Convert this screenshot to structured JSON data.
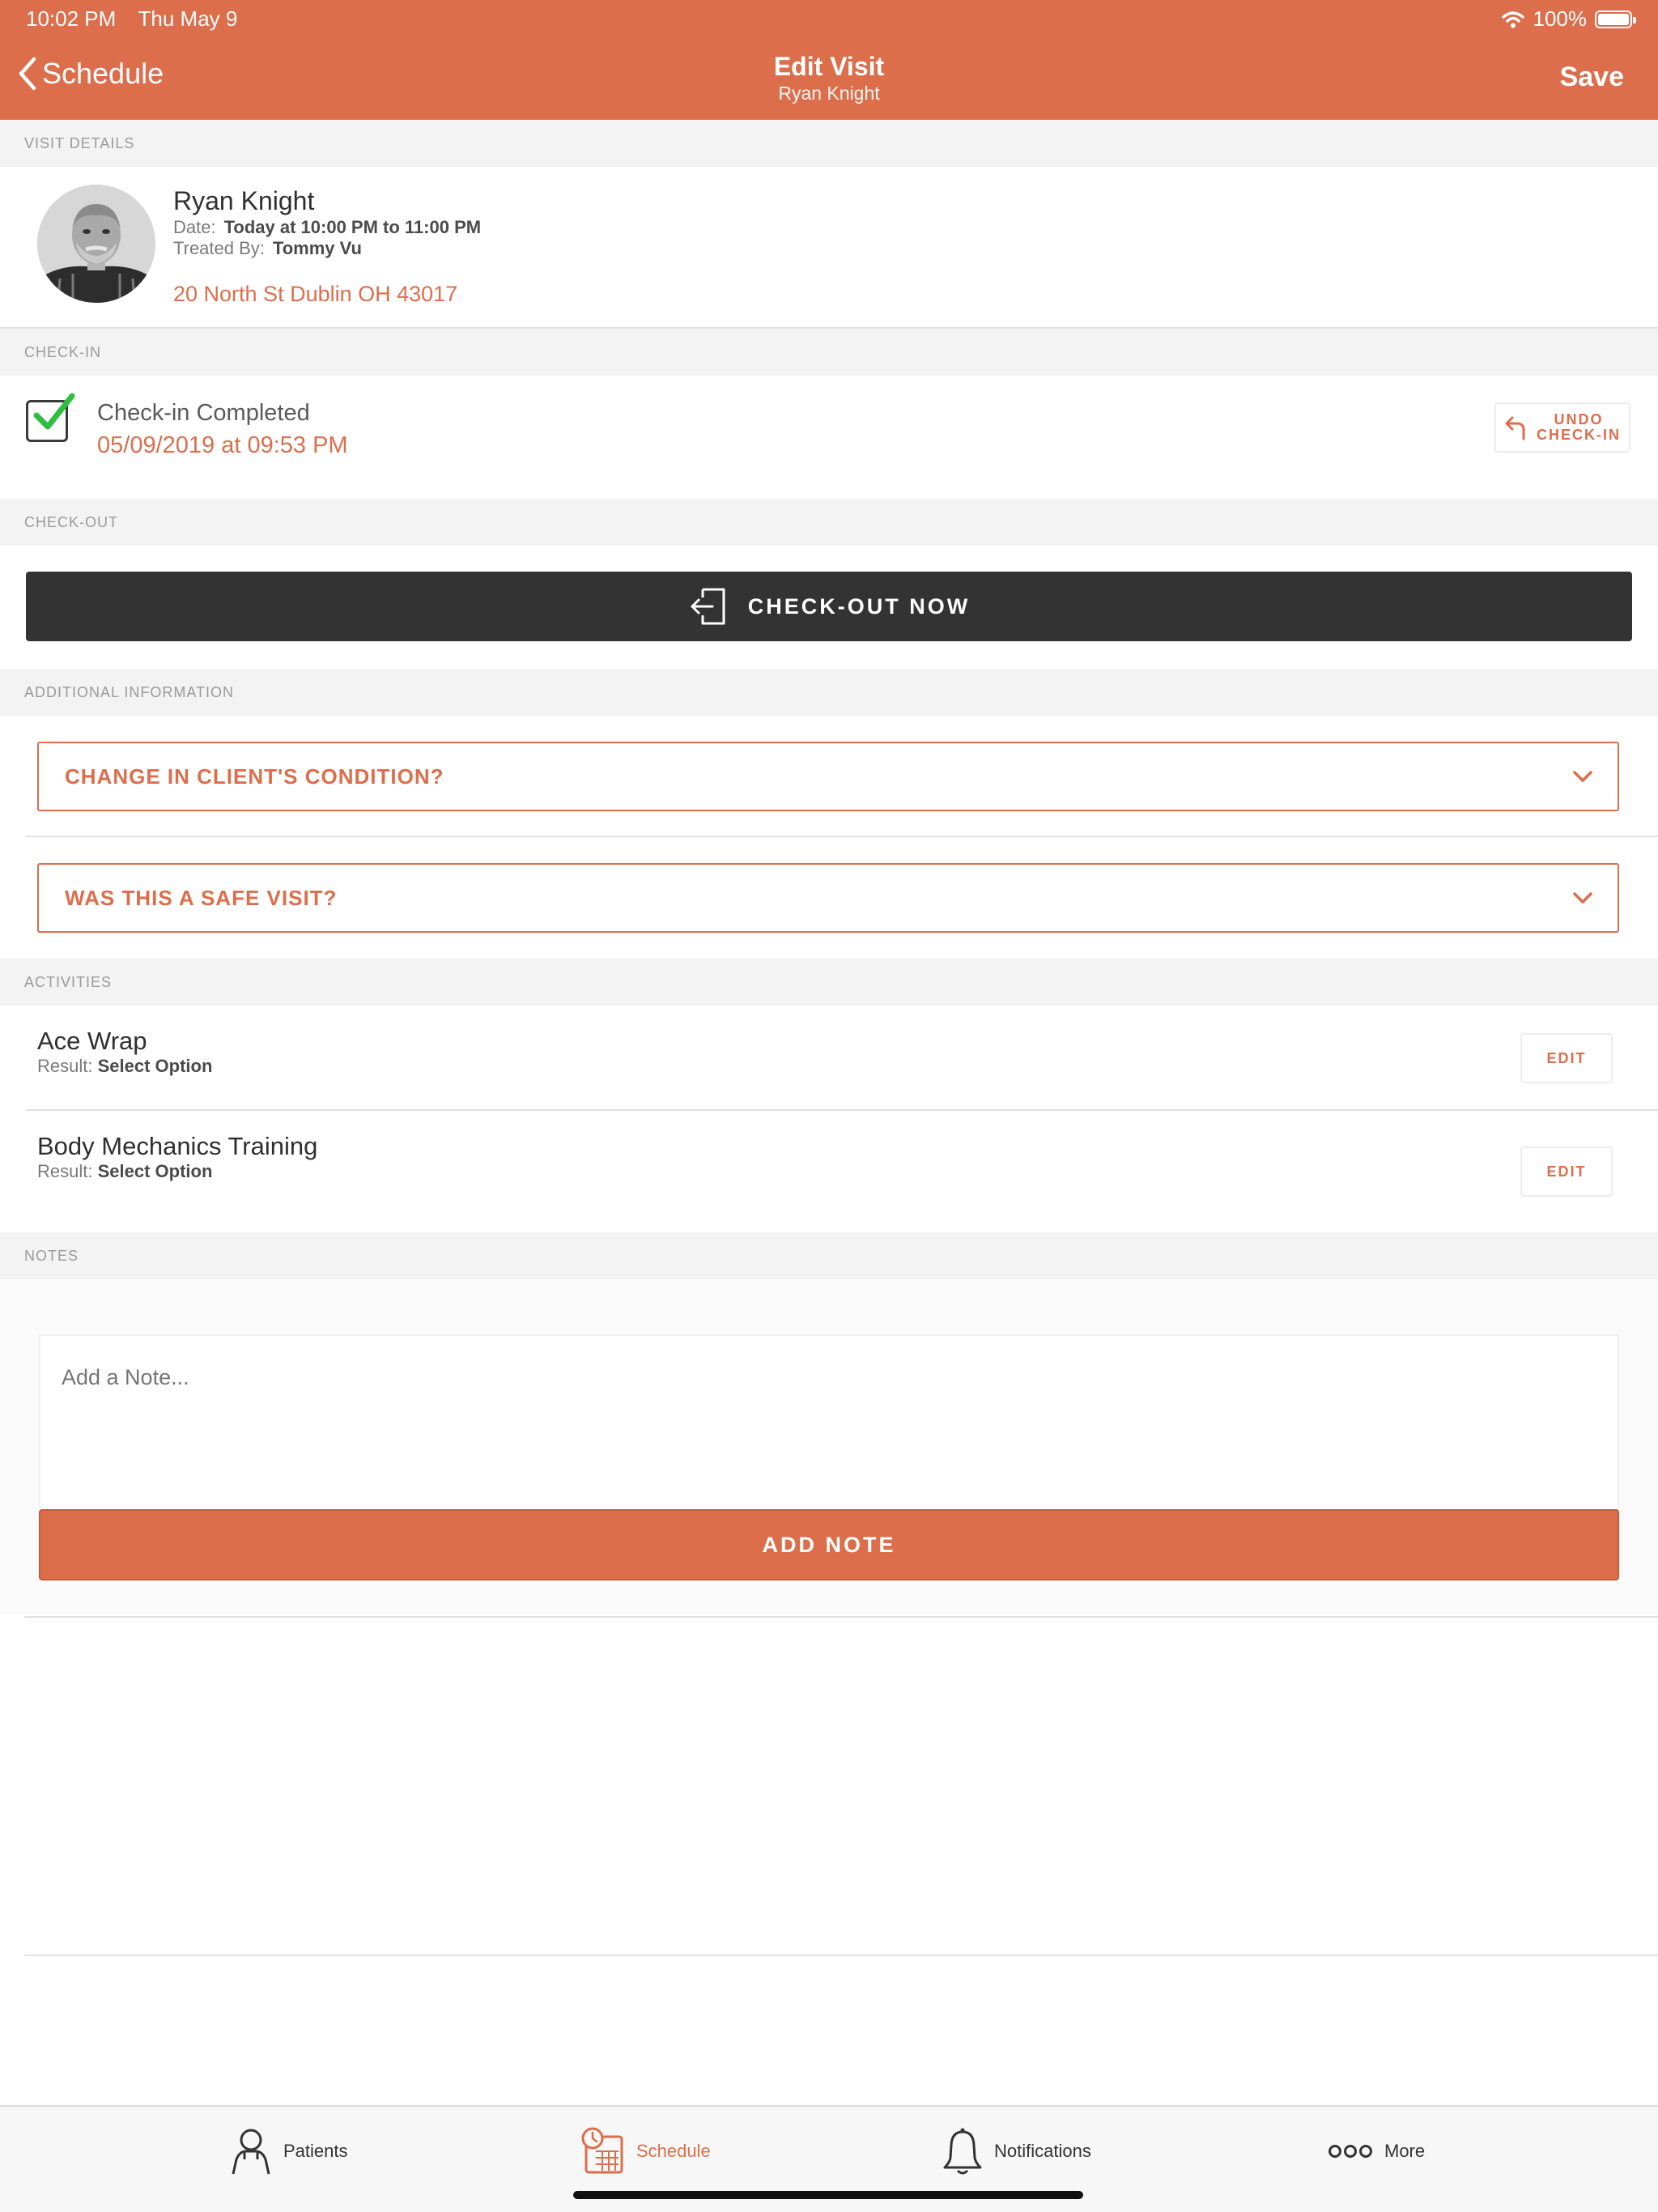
{
  "status_bar": {
    "time": "10:02 PM",
    "date": "Thu May 9",
    "battery": "100%"
  },
  "nav": {
    "back_label": "Schedule",
    "title": "Edit Visit",
    "subtitle": "Ryan Knight",
    "save_label": "Save"
  },
  "visit_details": {
    "header": "VISIT DETAILS",
    "patient_name": "Ryan Knight",
    "date_label": "Date:",
    "date_value": "Today at 10:00 PM to 11:00 PM",
    "treated_label": "Treated By:",
    "treated_value": "Tommy Vu",
    "address": "20 North St Dublin OH 43017"
  },
  "check_in": {
    "header": "CHECK-IN",
    "status": "Check-in Completed",
    "timestamp": "05/09/2019 at 09:53 PM",
    "undo_line1": "UNDO",
    "undo_line2": "CHECK-IN"
  },
  "check_out": {
    "header": "CHECK-OUT",
    "button_label": "CHECK-OUT NOW"
  },
  "additional_info": {
    "header": "ADDITIONAL INFORMATION",
    "questions": [
      "CHANGE IN CLIENT'S CONDITION?",
      "WAS THIS A SAFE VISIT?"
    ]
  },
  "activities": {
    "header": "ACTIVITIES",
    "items": [
      {
        "name": "Ace Wrap",
        "result_label": "Result:",
        "result_value": "Select Option",
        "edit_label": "EDIT"
      },
      {
        "name": "Body Mechanics Training",
        "result_label": "Result:",
        "result_value": "Select Option",
        "edit_label": "EDIT"
      }
    ]
  },
  "notes": {
    "header": "NOTES",
    "placeholder": "Add a Note...",
    "add_button": "ADD NOTE"
  },
  "tabbar": {
    "items": [
      {
        "label": "Patients",
        "icon": "person-icon"
      },
      {
        "label": "Schedule",
        "icon": "calendar-clock-icon",
        "active": true
      },
      {
        "label": "Notifications",
        "icon": "bell-icon"
      },
      {
        "label": "More",
        "icon": "more-dots-icon"
      }
    ]
  },
  "colors": {
    "accent": "#dd6e4c",
    "dark_button": "#333333",
    "section_bg": "#f3f3f3",
    "check_green": "#2fbf3f"
  }
}
